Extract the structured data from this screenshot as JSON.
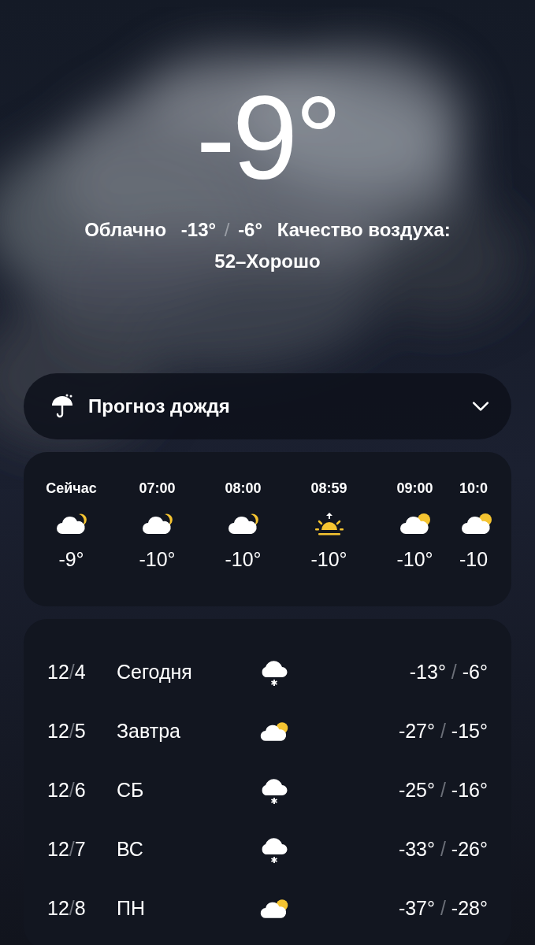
{
  "current": {
    "temperature": "-9°",
    "condition": "Облачно",
    "low": "-13°",
    "separator": "/",
    "high": "-6°",
    "air_quality_label": "Качество воздуха:",
    "air_quality_value": "52–Хорошо"
  },
  "rain_forecast": {
    "label": "Прогноз дождя",
    "expanded": false
  },
  "hourly": [
    {
      "time": "Сейчас",
      "kind": "cloud-moon",
      "temp": "-9°"
    },
    {
      "time": "07:00",
      "kind": "cloud-moon",
      "temp": "-10°"
    },
    {
      "time": "08:00",
      "kind": "cloud-moon",
      "temp": "-10°"
    },
    {
      "time": "08:59",
      "kind": "sunrise",
      "temp": "-10°"
    },
    {
      "time": "09:00",
      "kind": "cloud-sun",
      "temp": "-10°"
    },
    {
      "time": "10:0",
      "kind": "cloud-sun",
      "temp": "-10"
    }
  ],
  "daily": [
    {
      "month": "12",
      "date_separator": "/",
      "day": "4",
      "name": "Сегодня",
      "kind": "snow",
      "low": "-13°",
      "range_separator": "/",
      "high": "-6°"
    },
    {
      "month": "12",
      "date_separator": "/",
      "day": "5",
      "name": "Завтра",
      "kind": "cloud-sun",
      "low": "-27°",
      "range_separator": "/",
      "high": "-15°"
    },
    {
      "month": "12",
      "date_separator": "/",
      "day": "6",
      "name": "СБ",
      "kind": "snow",
      "low": "-25°",
      "range_separator": "/",
      "high": "-16°"
    },
    {
      "month": "12",
      "date_separator": "/",
      "day": "7",
      "name": "ВС",
      "kind": "snow",
      "low": "-33°",
      "range_separator": "/",
      "high": "-26°"
    },
    {
      "month": "12",
      "date_separator": "/",
      "day": "8",
      "name": "ПН",
      "kind": "cloud-sun",
      "low": "-37°",
      "range_separator": "/",
      "high": "-28°"
    }
  ]
}
